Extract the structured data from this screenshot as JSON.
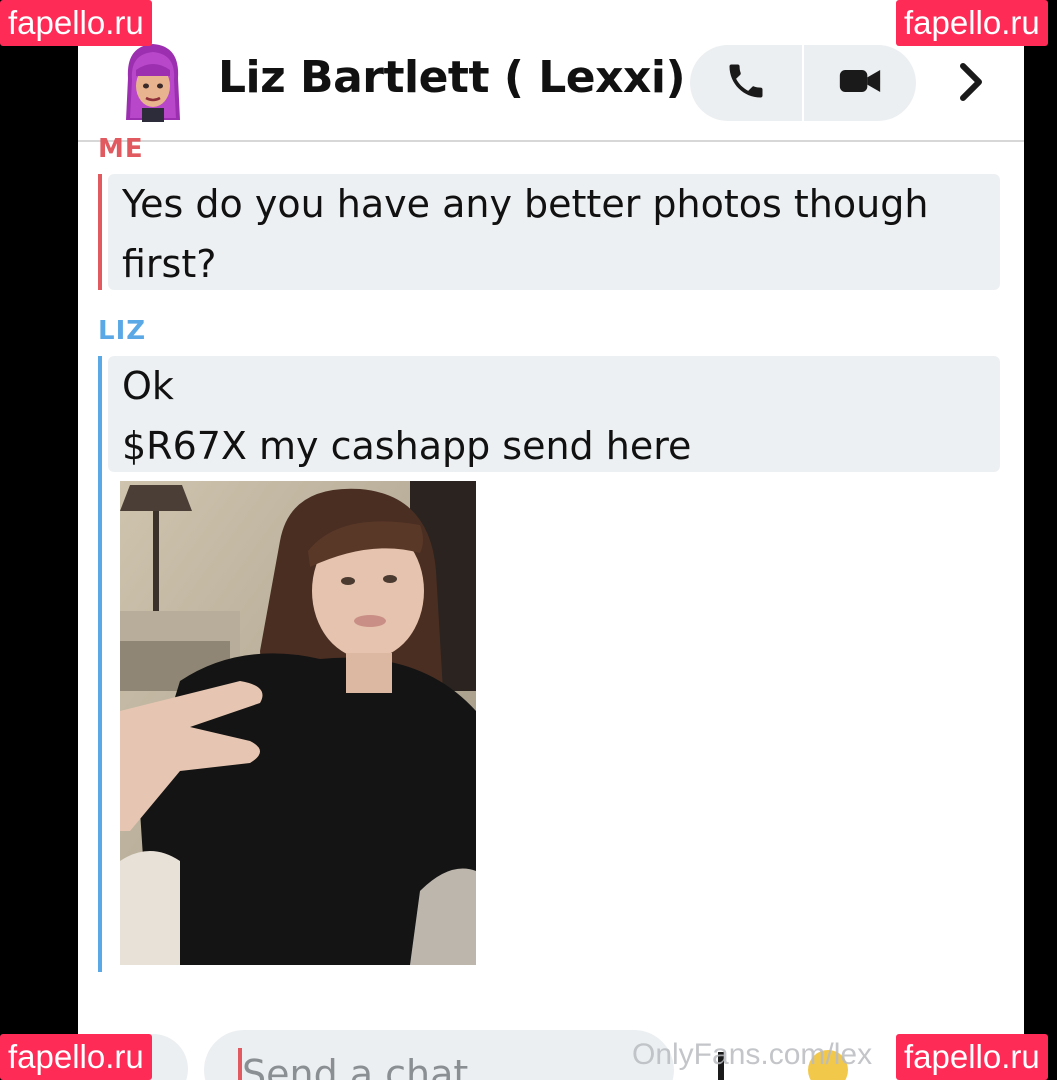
{
  "header": {
    "contact_name": "Liz Bartlett ( Lexxi)",
    "avatar_icon": "bitmoji-avatar-icon",
    "phone_icon": "phone-icon",
    "video_icon": "video-camera-icon",
    "chevron_icon": "chevron-right-icon"
  },
  "messages": [
    {
      "sender": "ME",
      "sender_color": "#e05a60",
      "lines": [
        "Yes do you have any better photos though",
        "first?"
      ]
    },
    {
      "sender": "LIZ",
      "sender_color": "#5aa9e6",
      "lines": [
        "Ok",
        "$R67X my cashapp send here"
      ],
      "attachment": "selfie-photo"
    }
  ],
  "composer": {
    "placeholder": "Send a chat"
  },
  "watermarks": {
    "top_left": "fapello.ru",
    "top_right": "fapello.ru",
    "bottom_left": "fapello.ru",
    "bottom_right": "fapello.ru",
    "onlyfans": "OnlyFans.com/lex"
  },
  "colors": {
    "me_accent": "#e05a60",
    "liz_accent": "#5aa9e6",
    "bubble_bg": "#edf0f2",
    "watermark_bg": "#ff2b57"
  }
}
